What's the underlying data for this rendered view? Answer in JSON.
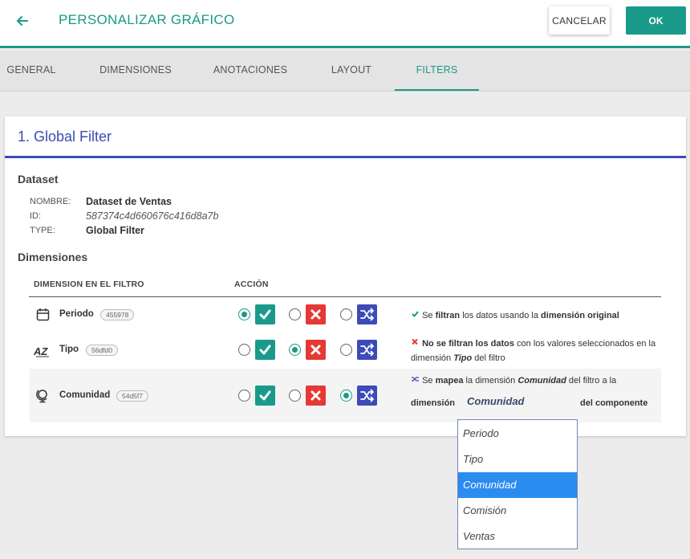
{
  "header": {
    "title": "PERSONALIZAR GRÁFICO",
    "cancel_label": "CANCELAR",
    "ok_label": "OK"
  },
  "tabs": [
    {
      "label": "GENERAL",
      "active": false
    },
    {
      "label": "DIMENSIONES",
      "active": false
    },
    {
      "label": "ANOTACIONES",
      "active": false
    },
    {
      "label": "LAYOUT",
      "active": false
    },
    {
      "label": "FILTERS",
      "active": true
    }
  ],
  "card": {
    "title": "1.  Global Filter",
    "dataset_heading": "Dataset",
    "meta": {
      "nombre_key": "NOMBRE:",
      "nombre_val": "Dataset de Ventas",
      "id_key": "ID:",
      "id_val": "587374c4d660676c416d8a7b",
      "type_key": "TYPE:",
      "type_val": "Global Filter"
    },
    "dimensiones_heading": "Dimensiones",
    "columns": {
      "dimension": "DIMENSION EN EL FILTRO",
      "accion": "ACCIÓN"
    },
    "rows": [
      {
        "name": "Periodo",
        "badge": "455978",
        "icon": "calendar-icon",
        "selected": "filter"
      },
      {
        "name": "Tipo",
        "badge": "56dfd0",
        "icon": "sort-az-icon",
        "selected": "no-filter"
      },
      {
        "name": "Comunidad",
        "badge": "54d5f7",
        "icon": "globe-icon",
        "selected": "map"
      }
    ],
    "notes": {
      "filter": {
        "a": "Se ",
        "b": "filtran",
        "c": " los datos usando la ",
        "d": "dimensión original"
      },
      "nofilter": {
        "a": "No se filtran los datos",
        "b": " con los valores seleccionados en la",
        "c": "dimensión ",
        "d": "Tipo",
        "e": " del filtro"
      },
      "map": {
        "a": "Se ",
        "b": "mapea",
        "c": " la dimensión ",
        "d": "Comunidad",
        "e": " del filtro a la",
        "f": "dimensión",
        "g": "del componente"
      }
    },
    "map_select_value": "Comunidad"
  },
  "dropdown": {
    "options": [
      "Periodo",
      "Tipo",
      "Comunidad",
      "Comisión",
      "Ventas"
    ],
    "selected_index": 2
  },
  "colors": {
    "teal": "#1a9a8a",
    "blue": "#3b4bb8",
    "red": "#e53935",
    "highlight": "#2b8cf0"
  }
}
